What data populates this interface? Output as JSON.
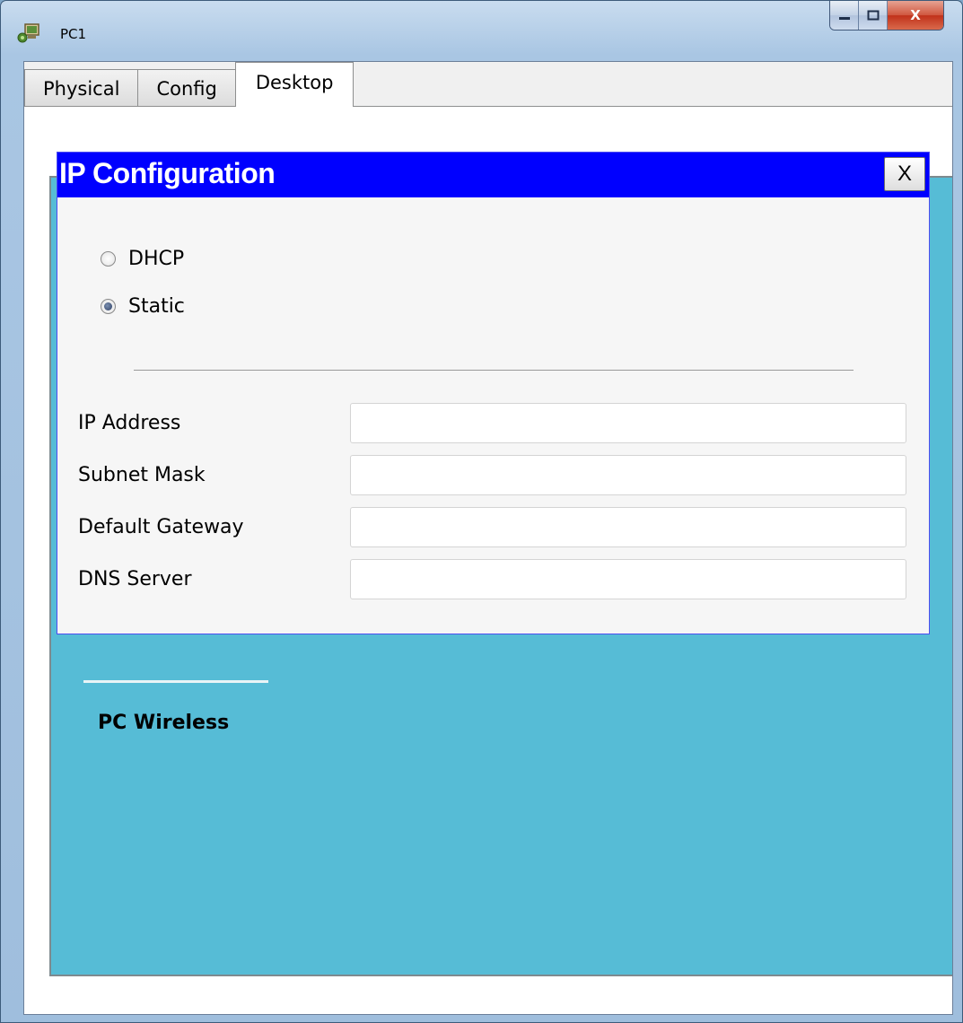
{
  "window": {
    "title": "PC1",
    "minimize_icon": "minimize-icon",
    "maximize_icon": "maximize-icon",
    "close_label": "X"
  },
  "tabs": [
    {
      "label": "Physical",
      "active": false
    },
    {
      "label": "Config",
      "active": false
    },
    {
      "label": "Desktop",
      "active": true
    }
  ],
  "ip_config": {
    "title": "IP Configuration",
    "close_label": "X",
    "modes": [
      {
        "label": "DHCP",
        "selected": false
      },
      {
        "label": "Static",
        "selected": true
      }
    ],
    "fields": [
      {
        "label": "IP Address",
        "value": ""
      },
      {
        "label": "Subnet Mask",
        "value": ""
      },
      {
        "label": "Default Gateway",
        "value": ""
      },
      {
        "label": "DNS Server",
        "value": ""
      }
    ]
  },
  "desktop": {
    "app_label": "PC Wireless",
    "background_color": "#56bcd6"
  },
  "colors": {
    "dialog_title_bg": "#0000ff",
    "dialog_title_text": "#ffffff"
  }
}
